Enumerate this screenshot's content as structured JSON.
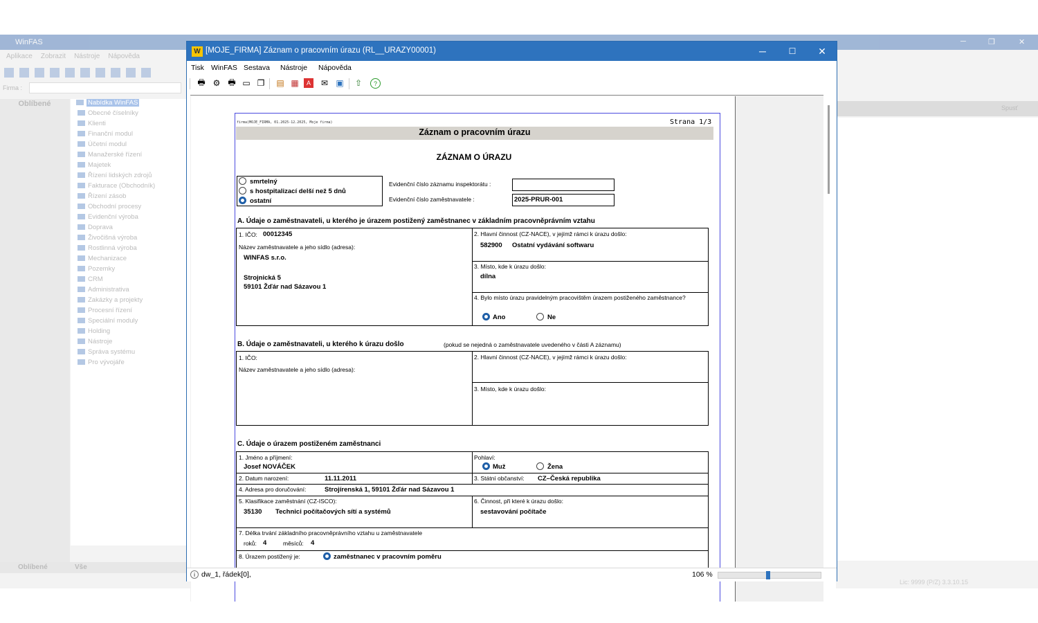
{
  "background_app": {
    "title": "WinFAS",
    "menu": [
      "Aplikace",
      "Zobrazit",
      "Nástroje",
      "Nápověda"
    ],
    "firma_label": "Firma :",
    "favorites_tab": "Oblíbené",
    "tree": [
      "Nabídka WinFAS",
      "Obecné číselníky",
      "Klienti",
      "Finanční modul",
      "Účetní modul",
      "Manažerské řízení",
      "Majetek",
      "Řízení lidských zdrojů",
      "Fakturace (Obchodník)",
      "Řízení zásob",
      "Obchodní procesy",
      "Evidenční výroba",
      "Doprava",
      "Živočišná výroba",
      "Rostlinná výroba",
      "Mechanizace",
      "Pozemky",
      "CRM",
      "Administrativa",
      "Zakázky a projekty",
      "Procesní řízení",
      "Speciální moduly",
      "Holding",
      "Nástroje",
      "Správa systému",
      "Pro vývojáře"
    ],
    "bottom_tabs": [
      "Oblíbené",
      "Vše"
    ],
    "run_label": "Spusť",
    "status": "Lic: 9999 (P/Z)      3.3.10.15"
  },
  "window": {
    "title": "[MOJE_FIRMA] Záznam o pracovním úrazu (RL__URAZY00001)",
    "logo": "W",
    "controls": {
      "minimize": "─",
      "maximize": "☐",
      "close": "✕"
    },
    "menu": [
      "Tisk",
      "WinFAS",
      "Sestava",
      "Nástroje",
      "Nápověda"
    ],
    "status_text": "dw_1, řádek[0],",
    "zoom": "106 %",
    "zoom_fraction": 0.5
  },
  "report": {
    "firm_line": "firma(MOJE_FIRMA, 01.2025-12.2025, Moje firma)",
    "page": "Strana 1/3",
    "banner": "Záznam o pracovním úrazu",
    "heading": "ZÁZNAM O ÚRAZU",
    "severity": {
      "options": [
        "smrtelný",
        "s hostpitalizací delší než 5 dnů",
        "ostatní"
      ],
      "selected": 2
    },
    "evid_inspect_label": "Evidenční číslo záznamu inspektorátu :",
    "evid_inspect_value": "",
    "evid_employer_label": "Evidenční číslo zaměstnavatele :",
    "evid_employer_value": "2025-PRUR-001",
    "sectionA": {
      "title": "A. Údaje o zaměstnavateli, u kterého je úrazem postižený zaměstnanec v základním pracovněprávním vztahu",
      "ico_label": "1. IČO:",
      "ico": "00012345",
      "name_label": "Název zaměstnavatele a jeho sídlo (adresa):",
      "name": "WINFAS s.r.o.",
      "street": "Strojnická 5",
      "city": "59101 Žďár nad Sázavou 1",
      "nace_label": "2. Hlavní činnost (CZ-NACE), v jejímž rámci k úrazu došlo:",
      "nace_code": "582900",
      "nace_text": "Ostatní vydávání softwaru",
      "place_label": "3. Místo, kde k úrazu došlo:",
      "place": "dílna",
      "regular_label": "4. Bylo místo úrazu pravidelným pracovištěm úrazem postiženého zaměstnance?",
      "yes": "Ano",
      "no": "Ne"
    },
    "sectionB": {
      "title": "B. Údaje o zaměstnavateli, u kterého k úrazu došlo",
      "note": "(pokud se nejedná o zaměstnavatele uvedeného v části A záznamu)",
      "ico_label": "1. IČO:",
      "name_label": "Název zaměstnavatele a jeho sídlo (adresa):",
      "nace_label": "2. Hlavní činnost (CZ-NACE), v jejímž rámci k úrazu došlo:",
      "place_label": "3. Místo, kde k úrazu došlo:"
    },
    "sectionC": {
      "title": "C. Údaje o úrazem postiženém zaměstnanci",
      "name_label": "1. Jméno a příjmení:",
      "name": "Josef NOVÁČEK",
      "sex_label": "Pohlaví:",
      "male": "Muž",
      "female": "Žena",
      "dob_label": "2. Datum narození:",
      "dob": "11.11.2011",
      "citizen_label": "3. Státní občanství:",
      "citizen": "CZ–Česká republika",
      "address_label": "4. Adresa pro doručování:",
      "address": "Strojírenská 1, 59101 Žďár nad Sázavou 1",
      "isco_label": "5. Klasifikace zaměstnání (CZ-ISCO):",
      "isco_code": "35130",
      "isco_text": "Technici počítačových sítí a systémů",
      "activity_label": "6. Činnost, při které k úrazu došlo:",
      "activity": "sestavování počítače",
      "duration_label": "7. Délka trvání základního pracovněprávního vztahu u zaměstnavatele",
      "years_label": "roků:",
      "years": "4",
      "months_label": "měsíců:",
      "months": "4",
      "injured_label": "8. Úrazem postižený je:",
      "injured": "zaměstnanec v pracovním poměru"
    }
  }
}
